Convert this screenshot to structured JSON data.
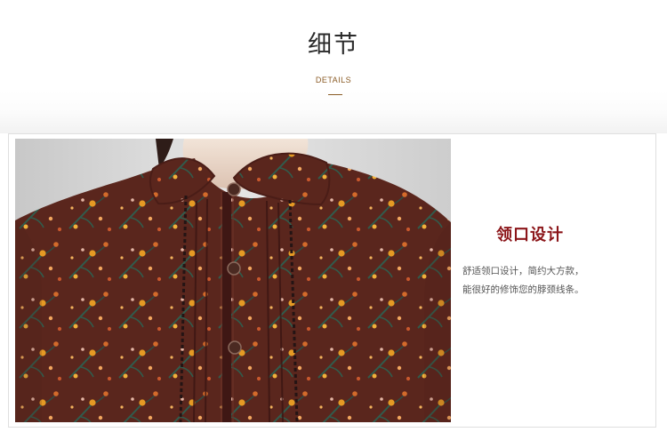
{
  "header": {
    "title": "细节",
    "subtitle": "DETAILS"
  },
  "feature": {
    "title": "领口设计",
    "description_lines": [
      "舒适领口设计，简约大方款，",
      "能很好的修饰您的脖颈线条。"
    ]
  },
  "colors": {
    "subtitle_accent": "#8a5b25",
    "feature_title": "#8b1519",
    "fabric_brown": "#5a261d",
    "flower_orange": "#e59a24",
    "leaf_green": "#2f5c4d"
  },
  "image": {
    "name": "collar-detail-photo"
  }
}
